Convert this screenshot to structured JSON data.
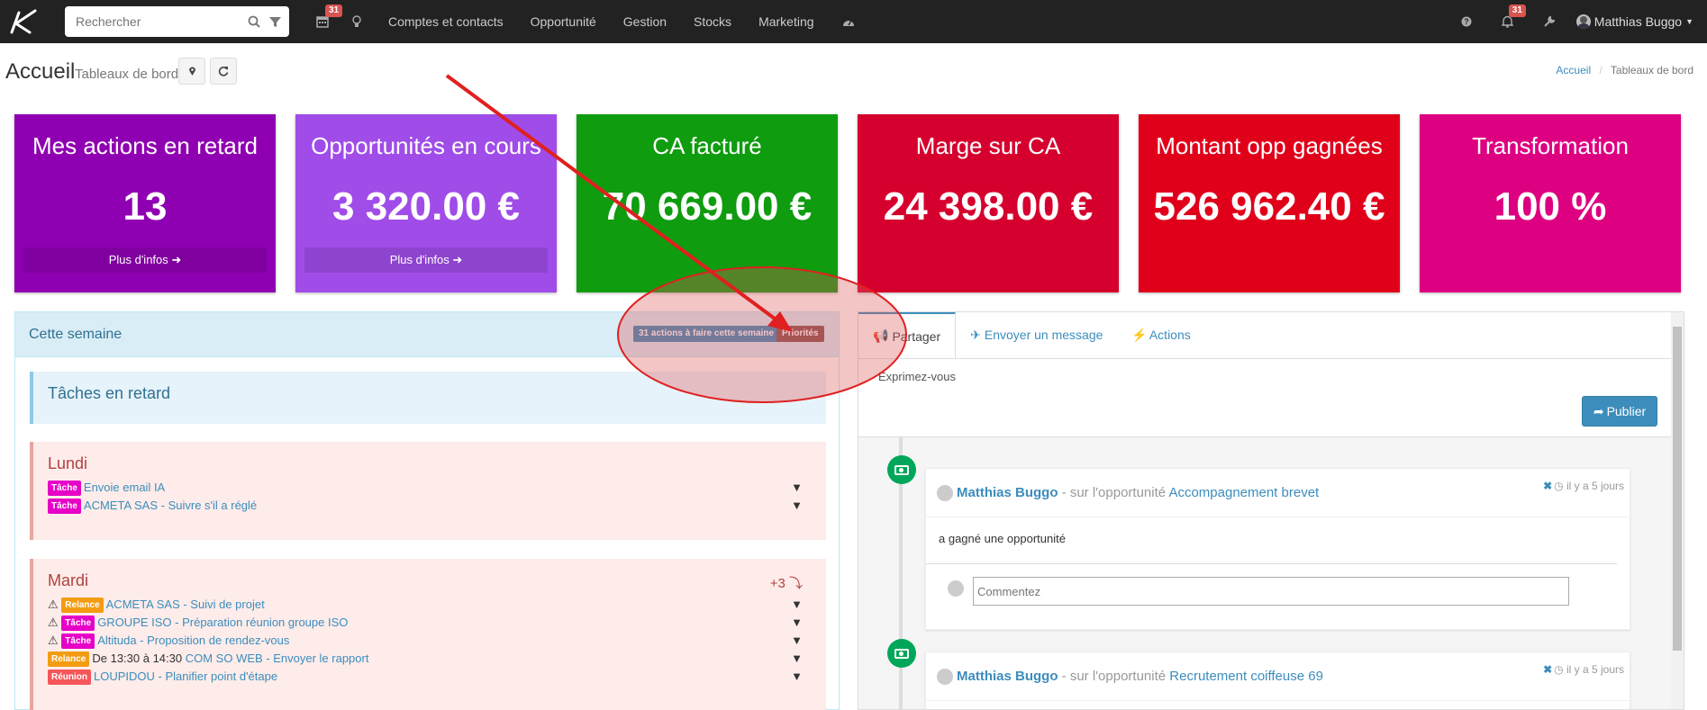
{
  "search": {
    "placeholder": "Rechercher"
  },
  "nav": {
    "calendar_badge": "31",
    "notif_badge": "31",
    "menu": [
      "Comptes et contacts",
      "Opportunité",
      "Gestion",
      "Stocks",
      "Marketing"
    ],
    "user": "Matthias Buggo"
  },
  "page": {
    "title": "Accueil",
    "subtitle": "Tableaux de bord"
  },
  "breadcrumb": {
    "home": "Accueil",
    "current": "Tableaux de bord"
  },
  "tiles": [
    {
      "title": "Mes actions en retard",
      "value": "13",
      "more": "Plus d'infos",
      "color": "#8f00b2"
    },
    {
      "title": "Opportunités en cours",
      "value": "3 320.00 €",
      "more": "Plus d'infos",
      "color": "#a04ce8"
    },
    {
      "title": "CA facturé",
      "value": "70 669.00 €",
      "color": "#0f9c0f"
    },
    {
      "title": "Marge sur CA",
      "value": "24 398.00 €",
      "color": "#d6002e"
    },
    {
      "title": "Montant opp gagnées",
      "value": "526 962.40 €",
      "color": "#e0001a"
    },
    {
      "title": "Transformation",
      "value": "100 %",
      "color": "#dd0080"
    }
  ],
  "week": {
    "title": "Cette semaine",
    "actions_label": "31 actions à faire cette semaine",
    "priorities_label": "Priorités",
    "overdue": "Tâches en retard",
    "lundi": {
      "title": "Lundi",
      "items": [
        {
          "tag": "Tâche",
          "text": "Envoie email IA"
        },
        {
          "tag": "Tâche",
          "text": "ACMETA SAS - Suivre s'il a réglé"
        }
      ]
    },
    "mardi": {
      "title": "Mardi",
      "extra": "+3",
      "items": [
        {
          "tag": "Relance",
          "time": "",
          "text": "ACMETA SAS - Suivi de projet"
        },
        {
          "tag": "Tâche",
          "time": "",
          "text": "GROUPE ISO - Préparation réunion groupe ISO"
        },
        {
          "tag": "Tâche",
          "time": "",
          "text": "Altituda - Proposition de rendez-vous"
        },
        {
          "tag": "Relance",
          "time": "De 13:30 à 14:30",
          "text": "COM SO WEB - Envoyer le rapport"
        },
        {
          "tag": "Réunion",
          "time": "",
          "text": "LOUPIDOU - Planifier point d'étape"
        }
      ]
    }
  },
  "feed": {
    "tabs": [
      "Partager",
      "Envoyer un message",
      "Actions"
    ],
    "placeholder": "Exprimez-vous",
    "publish": "Publier",
    "posts": [
      {
        "author": "Matthias Buggo",
        "context": "- sur l'opportunité",
        "link": "Accompagnement brevet",
        "time": "il y a 5 jours",
        "body": "a gagné une opportunité",
        "comment_placeholder": "Commentez"
      },
      {
        "author": "Matthias Buggo",
        "context": "- sur l'opportunité",
        "link": "Recrutement coiffeuse 69",
        "time": "il y a 5 jours"
      }
    ]
  },
  "colors": {
    "nav": "#222222",
    "link": "#3c8dbc",
    "tag_tache": "#e600c8",
    "tag_relance": "#f39c12",
    "tag_reunion": "#f5565b",
    "actions_badge": "#3c8dbc",
    "priorities_badge": "#8a5252"
  }
}
